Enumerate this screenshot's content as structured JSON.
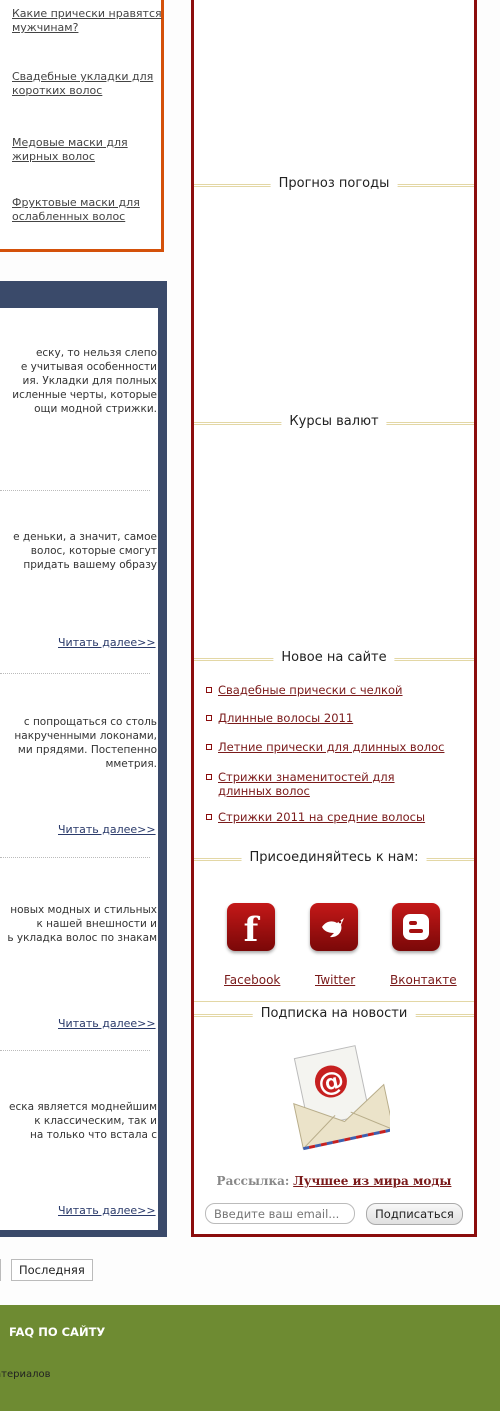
{
  "left_links": [
    "Какие прически нравятся мужчинам?",
    "Свадебные укладки для коротких волос",
    "Медовые маски для жирных волос",
    "Фруктовые маски для ослабленных волос"
  ],
  "articles": [
    {
      "excerpt": "еску, то нельзя слепо\nе учитывая особенности\nия. Укладки для полных\nисленные черты, которые\nощи модной стрижки.",
      "read_more": ""
    },
    {
      "excerpt": "е деньки, а значит, самое\n волос, которые смогут\n придать вашему образу",
      "read_more": "Читать далее>>"
    },
    {
      "excerpt": "с попрощаться со столь\n накрученными локонами,\nми прядями. Постепенно\nмметрия.",
      "read_more": "Читать далее>>"
    },
    {
      "excerpt": "новых модных и стильных\n к нашей внешности и\nь укладка волос по знакам",
      "read_more": "Читать далее>>"
    },
    {
      "excerpt": "еска является моднейшим\nк классическим, так и\nна только что встала с",
      "read_more": "Читать далее>>"
    }
  ],
  "sidebar": {
    "weather_title": "Прогноз погоды",
    "currency_title": "Курсы валют",
    "new_title": "Новое на сайте",
    "new_items": [
      "Свадебные прически с челкой",
      "Длинные волосы 2011",
      "Летние прически для длинных волос",
      "Стрижки знаменитостей для длинных волос",
      "Стрижки 2011 на средние волосы"
    ],
    "join_title": "Присоединяйтесь к нам:",
    "social": [
      "Facebook",
      "Twitter",
      "Вконтакте"
    ],
    "subscribe_title": "Подписка на новости",
    "mailing_label": "Рассылка:",
    "mailing_link": "Лучшее из мира моды",
    "email_placeholder": "Введите ваш email...",
    "subscribe_button": "Подписаться"
  },
  "pagination": {
    "last": "Последняя"
  },
  "footer": {
    "faq": "FAQ ПО САЙТУ",
    "materials": "атериалов"
  },
  "colors": {
    "accent_red": "#8b0d0d",
    "orange": "#d4510a",
    "navy": "#3a4a6a",
    "footer_green": "#6e8b32",
    "gold_line": "#e3d7a5"
  }
}
